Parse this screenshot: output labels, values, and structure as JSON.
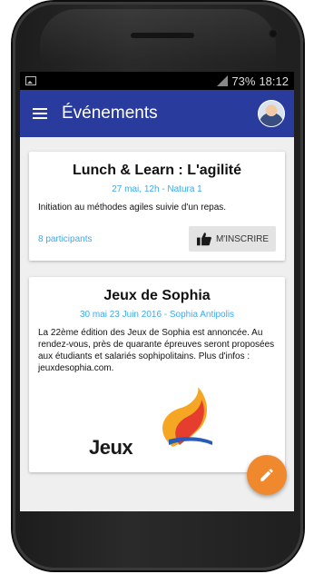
{
  "status_bar": {
    "battery": "73%",
    "time": "18:12"
  },
  "app_bar": {
    "title": "Événements",
    "menu_icon": "hamburger-menu-icon",
    "avatar_icon": "user-avatar-icon"
  },
  "events": [
    {
      "title": "Lunch & Learn : L'agilité",
      "subtitle": "27 mai, 12h - Natura 1",
      "description": "Initiation au méthodes agiles suivie d'un repas.",
      "participants": "8 participants",
      "register_label": "M'INSCRIRE"
    },
    {
      "title": "Jeux de Sophia",
      "subtitle": "30 mai 23 Juin 2016 - Sophia Antipolis",
      "description": "La 22ème édition des Jeux de Sophia est annoncée. Au rendez-vous, près de quarante épreuves seront proposées aux étudiants et salariés sophipolitains. Plus d'infos : jeuxdesophia.com.",
      "logo_text": "Jeux"
    }
  ],
  "fab": {
    "icon": "pencil-edit-icon"
  },
  "colors": {
    "app_bar": "#2a3b9e",
    "accent_blue": "#3da9ee",
    "fab": "#f0892e",
    "background": "#efefef"
  }
}
